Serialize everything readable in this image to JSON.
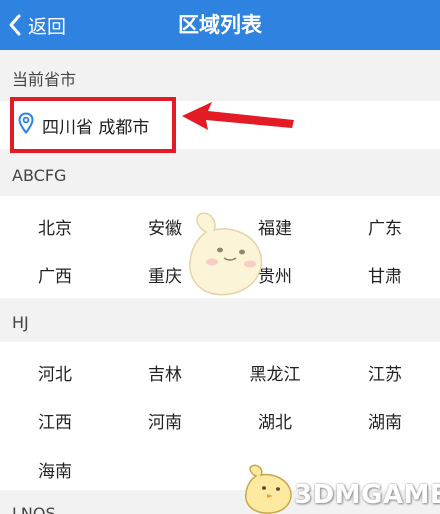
{
  "header": {
    "back_label": "返回",
    "title": "区域列表"
  },
  "current": {
    "section_label": "当前省市",
    "location": "四川省 成都市"
  },
  "groups": [
    {
      "label": "ABCFG",
      "items": [
        "北京",
        "安徽",
        "福建",
        "广东",
        "广西",
        "重庆",
        "贵州",
        "甘肃"
      ]
    },
    {
      "label": "HJ",
      "items": [
        "河北",
        "吉林",
        "黑龙江",
        "江苏",
        "江西",
        "河南",
        "湖北",
        "湖南",
        "海南"
      ]
    }
  ],
  "next_group_label": "LNQS",
  "watermark": "3DMGAME",
  "colors": {
    "header_bg": "#2f83e0",
    "highlight": "#e21b24",
    "pin": "#2f83e0"
  },
  "icons": {
    "back": "chevron-left-icon",
    "location": "location-pin-icon"
  }
}
